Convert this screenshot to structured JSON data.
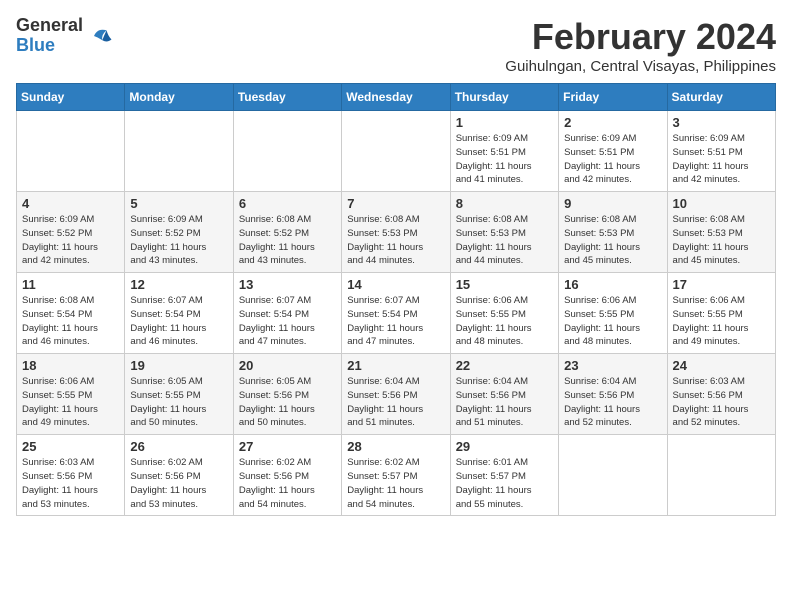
{
  "header": {
    "logo_general": "General",
    "logo_blue": "Blue",
    "month_title": "February 2024",
    "location": "Guihulngan, Central Visayas, Philippines"
  },
  "days_of_week": [
    "Sunday",
    "Monday",
    "Tuesday",
    "Wednesday",
    "Thursday",
    "Friday",
    "Saturday"
  ],
  "weeks": [
    [
      {
        "day": "",
        "info": ""
      },
      {
        "day": "",
        "info": ""
      },
      {
        "day": "",
        "info": ""
      },
      {
        "day": "",
        "info": ""
      },
      {
        "day": "1",
        "info": "Sunrise: 6:09 AM\nSunset: 5:51 PM\nDaylight: 11 hours\nand 41 minutes."
      },
      {
        "day": "2",
        "info": "Sunrise: 6:09 AM\nSunset: 5:51 PM\nDaylight: 11 hours\nand 42 minutes."
      },
      {
        "day": "3",
        "info": "Sunrise: 6:09 AM\nSunset: 5:51 PM\nDaylight: 11 hours\nand 42 minutes."
      }
    ],
    [
      {
        "day": "4",
        "info": "Sunrise: 6:09 AM\nSunset: 5:52 PM\nDaylight: 11 hours\nand 42 minutes."
      },
      {
        "day": "5",
        "info": "Sunrise: 6:09 AM\nSunset: 5:52 PM\nDaylight: 11 hours\nand 43 minutes."
      },
      {
        "day": "6",
        "info": "Sunrise: 6:08 AM\nSunset: 5:52 PM\nDaylight: 11 hours\nand 43 minutes."
      },
      {
        "day": "7",
        "info": "Sunrise: 6:08 AM\nSunset: 5:53 PM\nDaylight: 11 hours\nand 44 minutes."
      },
      {
        "day": "8",
        "info": "Sunrise: 6:08 AM\nSunset: 5:53 PM\nDaylight: 11 hours\nand 44 minutes."
      },
      {
        "day": "9",
        "info": "Sunrise: 6:08 AM\nSunset: 5:53 PM\nDaylight: 11 hours\nand 45 minutes."
      },
      {
        "day": "10",
        "info": "Sunrise: 6:08 AM\nSunset: 5:53 PM\nDaylight: 11 hours\nand 45 minutes."
      }
    ],
    [
      {
        "day": "11",
        "info": "Sunrise: 6:08 AM\nSunset: 5:54 PM\nDaylight: 11 hours\nand 46 minutes."
      },
      {
        "day": "12",
        "info": "Sunrise: 6:07 AM\nSunset: 5:54 PM\nDaylight: 11 hours\nand 46 minutes."
      },
      {
        "day": "13",
        "info": "Sunrise: 6:07 AM\nSunset: 5:54 PM\nDaylight: 11 hours\nand 47 minutes."
      },
      {
        "day": "14",
        "info": "Sunrise: 6:07 AM\nSunset: 5:54 PM\nDaylight: 11 hours\nand 47 minutes."
      },
      {
        "day": "15",
        "info": "Sunrise: 6:06 AM\nSunset: 5:55 PM\nDaylight: 11 hours\nand 48 minutes."
      },
      {
        "day": "16",
        "info": "Sunrise: 6:06 AM\nSunset: 5:55 PM\nDaylight: 11 hours\nand 48 minutes."
      },
      {
        "day": "17",
        "info": "Sunrise: 6:06 AM\nSunset: 5:55 PM\nDaylight: 11 hours\nand 49 minutes."
      }
    ],
    [
      {
        "day": "18",
        "info": "Sunrise: 6:06 AM\nSunset: 5:55 PM\nDaylight: 11 hours\nand 49 minutes."
      },
      {
        "day": "19",
        "info": "Sunrise: 6:05 AM\nSunset: 5:55 PM\nDaylight: 11 hours\nand 50 minutes."
      },
      {
        "day": "20",
        "info": "Sunrise: 6:05 AM\nSunset: 5:56 PM\nDaylight: 11 hours\nand 50 minutes."
      },
      {
        "day": "21",
        "info": "Sunrise: 6:04 AM\nSunset: 5:56 PM\nDaylight: 11 hours\nand 51 minutes."
      },
      {
        "day": "22",
        "info": "Sunrise: 6:04 AM\nSunset: 5:56 PM\nDaylight: 11 hours\nand 51 minutes."
      },
      {
        "day": "23",
        "info": "Sunrise: 6:04 AM\nSunset: 5:56 PM\nDaylight: 11 hours\nand 52 minutes."
      },
      {
        "day": "24",
        "info": "Sunrise: 6:03 AM\nSunset: 5:56 PM\nDaylight: 11 hours\nand 52 minutes."
      }
    ],
    [
      {
        "day": "25",
        "info": "Sunrise: 6:03 AM\nSunset: 5:56 PM\nDaylight: 11 hours\nand 53 minutes."
      },
      {
        "day": "26",
        "info": "Sunrise: 6:02 AM\nSunset: 5:56 PM\nDaylight: 11 hours\nand 53 minutes."
      },
      {
        "day": "27",
        "info": "Sunrise: 6:02 AM\nSunset: 5:56 PM\nDaylight: 11 hours\nand 54 minutes."
      },
      {
        "day": "28",
        "info": "Sunrise: 6:02 AM\nSunset: 5:57 PM\nDaylight: 11 hours\nand 54 minutes."
      },
      {
        "day": "29",
        "info": "Sunrise: 6:01 AM\nSunset: 5:57 PM\nDaylight: 11 hours\nand 55 minutes."
      },
      {
        "day": "",
        "info": ""
      },
      {
        "day": "",
        "info": ""
      }
    ]
  ]
}
